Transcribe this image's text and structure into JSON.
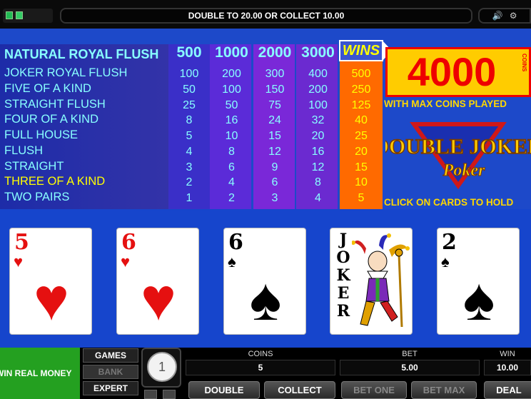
{
  "header": {
    "message": "DOUBLE TO 20.00 OR COLLECT 10.00",
    "sound_icon": "speaker-icon",
    "settings_icon": "gear-icon"
  },
  "paytable": {
    "columns": [
      "500",
      "1000",
      "2000",
      "3000"
    ],
    "wins_label": "WINS",
    "hands": [
      {
        "name": "NATURAL ROYAL FLUSH",
        "values": [
          "500",
          "1000",
          "2000",
          "3000"
        ],
        "win": ""
      },
      {
        "name": "JOKER ROYAL FLUSH",
        "values": [
          "100",
          "200",
          "300",
          "400"
        ],
        "win": "500"
      },
      {
        "name": "FIVE OF A KIND",
        "values": [
          "50",
          "100",
          "150",
          "200"
        ],
        "win": "250"
      },
      {
        "name": "STRAIGHT FLUSH",
        "values": [
          "25",
          "50",
          "75",
          "100"
        ],
        "win": "125"
      },
      {
        "name": "FOUR OF A KIND",
        "values": [
          "8",
          "16",
          "24",
          "32"
        ],
        "win": "40"
      },
      {
        "name": "FULL HOUSE",
        "values": [
          "5",
          "10",
          "15",
          "20"
        ],
        "win": "25"
      },
      {
        "name": "FLUSH",
        "values": [
          "4",
          "8",
          "12",
          "16"
        ],
        "win": "20"
      },
      {
        "name": "STRAIGHT",
        "values": [
          "3",
          "6",
          "9",
          "12"
        ],
        "win": "15"
      },
      {
        "name": "THREE OF A KIND",
        "values": [
          "2",
          "4",
          "6",
          "8"
        ],
        "win": "10"
      },
      {
        "name": "TWO PAIRS",
        "values": [
          "1",
          "2",
          "3",
          "4"
        ],
        "win": "5"
      }
    ],
    "highlight_hand": "THREE OF A KIND"
  },
  "promo": {
    "top_prize": "4000",
    "top_prize_unit": "COINS",
    "max_coins_text": "WITH MAX COINS PLAYED",
    "logo_line1": "DOUBLE JOKER",
    "logo_line2": "Poker",
    "instruction": "CLICK ON CARDS TO HOLD"
  },
  "cards": [
    {
      "rank": "5",
      "suit": "♥",
      "color": "red"
    },
    {
      "rank": "6",
      "suit": "♥",
      "color": "red"
    },
    {
      "rank": "6",
      "suit": "♠",
      "color": "black"
    },
    {
      "rank": "JOKER",
      "suit": "",
      "color": "black"
    },
    {
      "rank": "2",
      "suit": "♠",
      "color": "black"
    }
  ],
  "controls": {
    "real_money": "WIN REAL MONEY",
    "mode_buttons": [
      "GAMES",
      "BANK",
      "EXPERT"
    ],
    "dial_value": "1",
    "coins_label": "COINS",
    "coins_value": "5",
    "bet_label": "BET",
    "bet_value": "5.00",
    "win_label": "WIN",
    "win_value": "10.00",
    "buttons": [
      "DOUBLE",
      "COLLECT",
      "BET ONE",
      "BET MAX",
      "DEAL"
    ]
  },
  "colors": {
    "background_blue": "#1d49c9",
    "wins_column": "#ff6a00",
    "table_text": "#88ffff",
    "highlight": "#ffff00",
    "prize_red": "#ee0000"
  }
}
